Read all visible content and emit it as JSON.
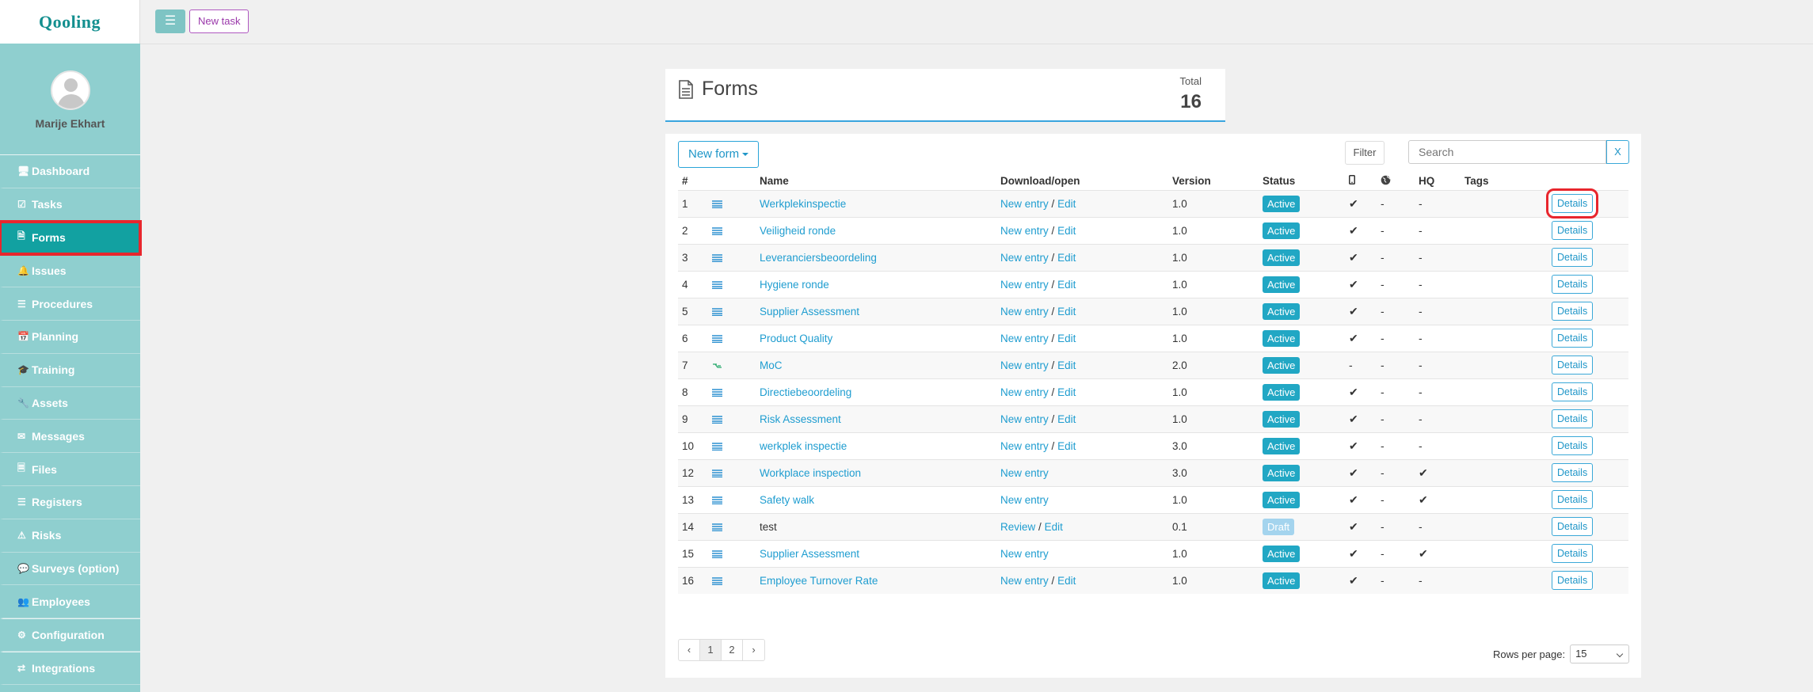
{
  "app": {
    "logo": "Qooling"
  },
  "user": {
    "name": "Marije Ekhart"
  },
  "sidebar": {
    "items": [
      {
        "label": "Dashboard",
        "icon": "monitor-icon"
      },
      {
        "label": "Tasks",
        "icon": "checkbox-icon"
      },
      {
        "label": "Forms",
        "icon": "document-icon"
      },
      {
        "label": "Issues",
        "icon": "bell-icon"
      },
      {
        "label": "Procedures",
        "icon": "list-icon"
      },
      {
        "label": "Planning",
        "icon": "calendar-icon"
      },
      {
        "label": "Training",
        "icon": "graduation-icon"
      },
      {
        "label": "Assets",
        "icon": "wrench-icon"
      },
      {
        "label": "Messages",
        "icon": "envelope-icon"
      },
      {
        "label": "Files",
        "icon": "file-icon"
      },
      {
        "label": "Registers",
        "icon": "list-icon"
      },
      {
        "label": "Risks",
        "icon": "warning-icon"
      },
      {
        "label": "Surveys (option)",
        "icon": "chat-icon"
      },
      {
        "label": "Employees",
        "icon": "users-icon"
      },
      {
        "label": "Configuration",
        "icon": "gear-icon"
      },
      {
        "label": "Integrations",
        "icon": "exchange-icon"
      }
    ],
    "active": "Forms"
  },
  "topbar": {
    "new_task_label": "New task"
  },
  "page": {
    "title": "Forms",
    "total_label": "Total",
    "total_value": "16"
  },
  "toolbar": {
    "new_form_label": "New form",
    "filter_label": "Filter",
    "search_placeholder": "Search",
    "clear_label": "X"
  },
  "table": {
    "columns": [
      "#",
      "",
      "Name",
      "Download/open",
      "Version",
      "Status",
      "",
      "",
      "HQ",
      "Tags",
      ""
    ],
    "rows": [
      {
        "num": "1",
        "name": "Werkplekinspectie",
        "action1": "New entry",
        "action2": "Edit",
        "version": "1.0",
        "status": "Active",
        "mobile": "✔",
        "web": "-",
        "hq": "-",
        "details": "Details"
      },
      {
        "num": "2",
        "name": "Veiligheid ronde",
        "action1": "New entry",
        "action2": "Edit",
        "version": "1.0",
        "status": "Active",
        "mobile": "✔",
        "web": "-",
        "hq": "-",
        "details": "Details"
      },
      {
        "num": "3",
        "name": "Leveranciersbeoordeling",
        "action1": "New entry",
        "action2": "Edit",
        "version": "1.0",
        "status": "Active",
        "mobile": "✔",
        "web": "-",
        "hq": "-",
        "details": "Details"
      },
      {
        "num": "4",
        "name": "Hygiene ronde",
        "action1": "New entry",
        "action2": "Edit",
        "version": "1.0",
        "status": "Active",
        "mobile": "✔",
        "web": "-",
        "hq": "-",
        "details": "Details"
      },
      {
        "num": "5",
        "name": "Supplier Assessment",
        "action1": "New entry",
        "action2": "Edit",
        "version": "1.0",
        "status": "Active",
        "mobile": "✔",
        "web": "-",
        "hq": "-",
        "details": "Details"
      },
      {
        "num": "6",
        "name": "Product Quality",
        "action1": "New entry",
        "action2": "Edit",
        "version": "1.0",
        "status": "Active",
        "mobile": "✔",
        "web": "-",
        "hq": "-",
        "details": "Details"
      },
      {
        "num": "7",
        "name": "MoC",
        "action1": "New entry",
        "action2": "Edit",
        "version": "2.0",
        "status": "Active",
        "mobile": "-",
        "web": "-",
        "hq": "-",
        "details": "Details"
      },
      {
        "num": "8",
        "name": "Directiebeoordeling",
        "action1": "New entry",
        "action2": "Edit",
        "version": "1.0",
        "status": "Active",
        "mobile": "✔",
        "web": "-",
        "hq": "-",
        "details": "Details"
      },
      {
        "num": "9",
        "name": "Risk Assessment",
        "action1": "New entry",
        "action2": "Edit",
        "version": "1.0",
        "status": "Active",
        "mobile": "✔",
        "web": "-",
        "hq": "-",
        "details": "Details"
      },
      {
        "num": "10",
        "name": "werkplek inspectie",
        "action1": "New entry",
        "action2": "Edit",
        "version": "3.0",
        "status": "Active",
        "mobile": "✔",
        "web": "-",
        "hq": "-",
        "details": "Details"
      },
      {
        "num": "12",
        "name": "Workplace inspection",
        "action1": "New entry",
        "action2": "",
        "version": "3.0",
        "status": "Active",
        "mobile": "✔",
        "web": "-",
        "hq": "✔",
        "details": "Details"
      },
      {
        "num": "13",
        "name": "Safety walk",
        "action1": "New entry",
        "action2": "",
        "version": "1.0",
        "status": "Active",
        "mobile": "✔",
        "web": "-",
        "hq": "✔",
        "details": "Details"
      },
      {
        "num": "14",
        "name": "test",
        "action1": "Review",
        "action2": "Edit",
        "version": "0.1",
        "status": "Draft",
        "mobile": "✔",
        "web": "-",
        "hq": "-",
        "details": "Details"
      },
      {
        "num": "15",
        "name": "Supplier Assessment",
        "action1": "New entry",
        "action2": "",
        "version": "1.0",
        "status": "Active",
        "mobile": "✔",
        "web": "-",
        "hq": "✔",
        "details": "Details"
      },
      {
        "num": "16",
        "name": "Employee Turnover Rate",
        "action1": "New entry",
        "action2": "Edit",
        "version": "1.0",
        "status": "Active",
        "mobile": "✔",
        "web": "-",
        "hq": "-",
        "details": "Details"
      }
    ]
  },
  "pagination": {
    "prev": "‹",
    "pages": [
      "1",
      "2"
    ],
    "current": "1",
    "next": "›"
  },
  "rows_per_page": {
    "label": "Rows per page:",
    "value": "15"
  },
  "colors": {
    "sidebar": "#8fcfcf",
    "active": "#12a1a1",
    "accent": "#1f9dd0",
    "highlight": "#e8262d"
  }
}
